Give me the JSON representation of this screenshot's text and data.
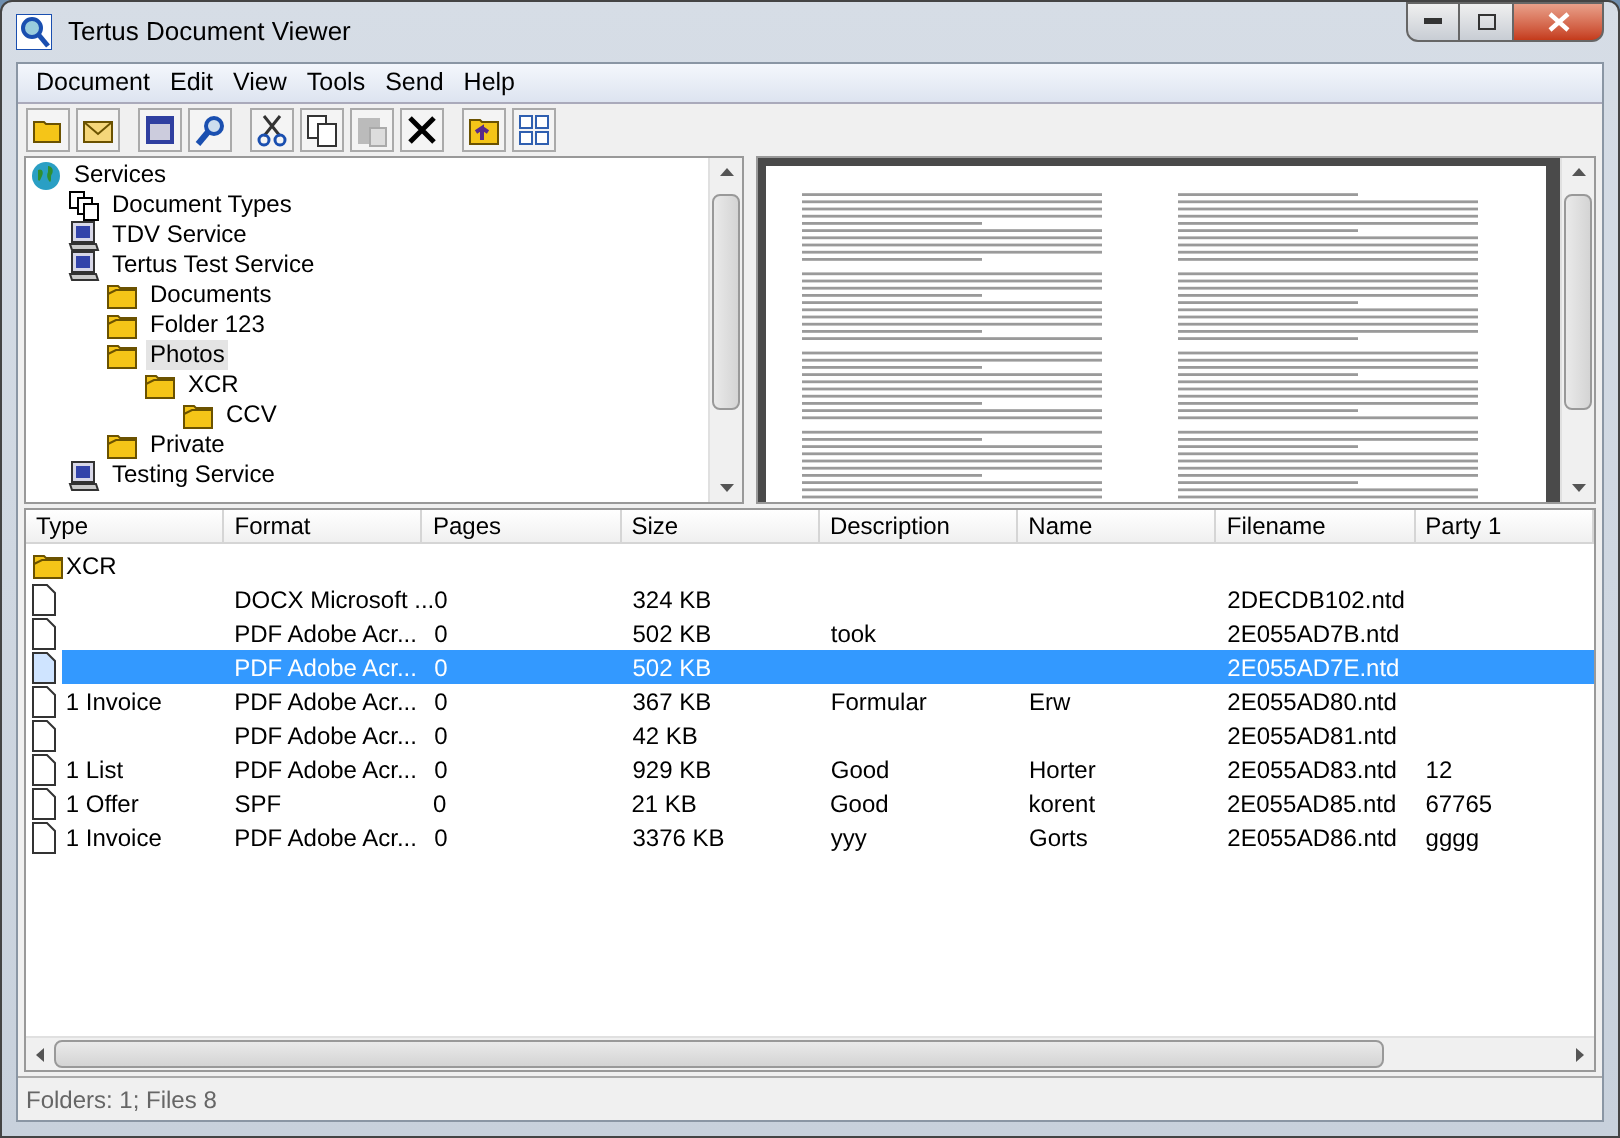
{
  "window": {
    "title": "Tertus Document Viewer"
  },
  "menu": [
    "Document",
    "Edit",
    "View",
    "Tools",
    "Send",
    "Help"
  ],
  "tree": [
    {
      "label": "Services",
      "kind": "globe",
      "selected": false,
      "children": [
        {
          "label": "Document Types",
          "kind": "types",
          "selected": false
        },
        {
          "label": "TDV Service",
          "kind": "service",
          "selected": false
        },
        {
          "label": "Tertus Test Service",
          "kind": "service",
          "selected": false,
          "children": [
            {
              "label": "Documents",
              "kind": "folder",
              "selected": false
            },
            {
              "label": "Folder 123",
              "kind": "folder",
              "selected": false
            },
            {
              "label": "Photos",
              "kind": "folder",
              "selected": true,
              "children": [
                {
                  "label": "XCR",
                  "kind": "folder",
                  "selected": false,
                  "children": [
                    {
                      "label": "CCV",
                      "kind": "folder",
                      "selected": false
                    }
                  ]
                }
              ]
            },
            {
              "label": "Private",
              "kind": "folder",
              "selected": false
            }
          ]
        },
        {
          "label": "Testing Service",
          "kind": "service",
          "selected": false
        }
      ]
    }
  ],
  "table": {
    "columns": [
      "Type",
      "Format",
      "Pages",
      "Size",
      "Description",
      "Name",
      "Filename",
      "Party 1"
    ],
    "rows": [
      {
        "kind": "folder",
        "selected": false,
        "cells": [
          "XCR",
          "",
          "",
          "",
          "",
          "",
          "",
          ""
        ]
      },
      {
        "kind": "file",
        "selected": false,
        "cells": [
          "",
          "DOCX Microsoft ...",
          "0",
          "324 KB",
          "",
          "",
          "2DECDB102.ntd",
          ""
        ]
      },
      {
        "kind": "file",
        "selected": false,
        "cells": [
          "",
          "PDF Adobe Acr...",
          "0",
          "502 KB",
          "took",
          "",
          "2E055AD7B.ntd",
          ""
        ]
      },
      {
        "kind": "file",
        "selected": true,
        "cells": [
          "",
          "PDF Adobe Acr...",
          "0",
          "502 KB",
          "",
          "",
          "2E055AD7E.ntd",
          ""
        ]
      },
      {
        "kind": "file",
        "selected": false,
        "cells": [
          "1 Invoice",
          "PDF Adobe Acr...",
          "0",
          "367 KB",
          "Formular",
          "Erw",
          "2E055AD80.ntd",
          ""
        ]
      },
      {
        "kind": "file",
        "selected": false,
        "cells": [
          "",
          "PDF Adobe Acr...",
          "0",
          "42 KB",
          "",
          "",
          "2E055AD81.ntd",
          ""
        ]
      },
      {
        "kind": "file",
        "selected": false,
        "cells": [
          "1 List",
          "PDF Adobe Acr...",
          "0",
          "929 KB",
          "Good",
          "Horter",
          "2E055AD83.ntd",
          "12"
        ]
      },
      {
        "kind": "file",
        "selected": false,
        "cells": [
          "1 Offer",
          "SPF",
          "0",
          "21 KB",
          "Good",
          "korent",
          "2E055AD85.ntd",
          "67765"
        ]
      },
      {
        "kind": "file",
        "selected": false,
        "cells": [
          "1 Invoice",
          "PDF Adobe Acr...",
          "0",
          "3376 KB",
          "yyy",
          "Gorts",
          "2E055AD86.ntd",
          "gggg"
        ]
      }
    ]
  },
  "status_bar": "Folders: 1; Files 8"
}
